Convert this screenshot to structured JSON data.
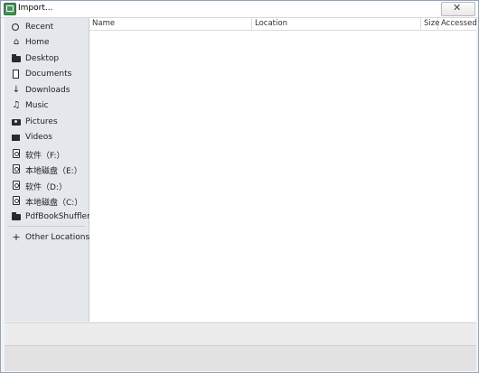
{
  "window": {
    "title": "Import..."
  },
  "sidebar": {
    "items": [
      {
        "label": "Recent",
        "icon": "clock-icon"
      },
      {
        "label": "Home",
        "icon": "home-icon"
      },
      {
        "label": "Desktop",
        "icon": "folder-icon"
      },
      {
        "label": "Documents",
        "icon": "document-icon"
      },
      {
        "label": "Downloads",
        "icon": "download-arrow-icon"
      },
      {
        "label": "Music",
        "icon": "music-note-icon"
      },
      {
        "label": "Pictures",
        "icon": "camera-icon"
      },
      {
        "label": "Videos",
        "icon": "video-icon"
      },
      {
        "label": "软件（F:）",
        "icon": "drive-icon"
      },
      {
        "label": "本地磁盘（E:）",
        "icon": "drive-icon"
      },
      {
        "label": "软件（D:）",
        "icon": "drive-icon"
      },
      {
        "label": "本地磁盘（C:）",
        "icon": "drive-icon"
      },
      {
        "label": "PdfBookShuffler",
        "icon": "folder-icon"
      },
      {
        "label": "Other Locations",
        "icon": "plus-icon"
      }
    ]
  },
  "file_list": {
    "columns": [
      "Name",
      "Location",
      "Size",
      "Accessed"
    ]
  }
}
